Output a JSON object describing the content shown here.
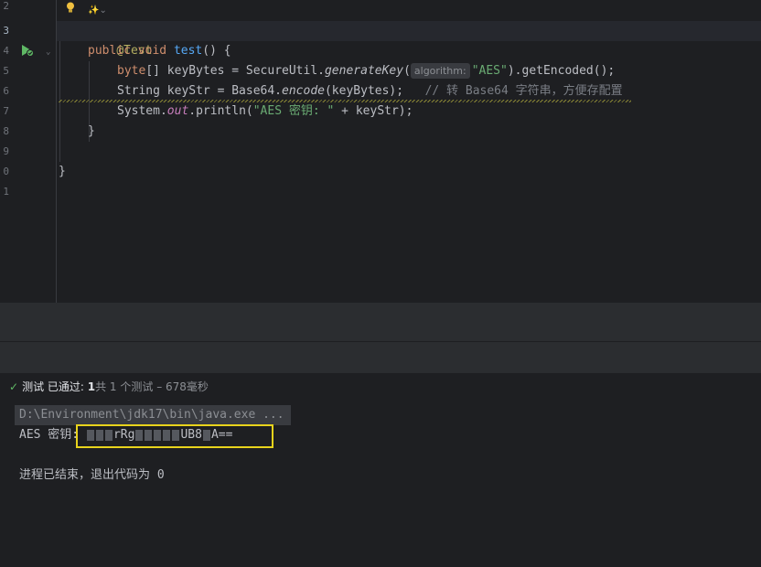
{
  "editor": {
    "line_numbers": [
      "2",
      "3",
      "4",
      "5",
      "6",
      "7",
      "8",
      "9",
      "0",
      "1"
    ],
    "ai_hint": "✨⌄",
    "lines": {
      "annotation": "@Test",
      "method_sig": {
        "kw1": "public",
        "kw2": "void",
        "name": "test",
        "rest": "() {"
      },
      "line5": {
        "kw": "byte",
        "a": "[] keyBytes = SecureUtil.",
        "m": "generateKey",
        "b": "(",
        "hint": "algorithm:",
        "str": "\"AES\"",
        "c": ").getEncoded();"
      },
      "line6": {
        "a": "String keyStr = Base64.",
        "m": "encode",
        "b": "(keyBytes);",
        "cmt": "// 转 Base64 字符串，方便存配置"
      },
      "line7": {
        "a": "System.",
        "f": "out",
        "b": ".println(",
        "str": "\"AES 密钥: \"",
        "c": " + keyStr);"
      },
      "close1": "}",
      "close2": "}"
    }
  },
  "tests": {
    "status_label": "测试 已通过:",
    "count": "1",
    "total": "共 1 个测试 – 678毫秒"
  },
  "console": {
    "command": "D:\\Environment\\jdk17\\bin\\java.exe ...",
    "output_prefix": "AES 密钥:",
    "output_key_visible_1": "rRg",
    "output_key_visible_2": "UB8",
    "output_key_suffix": "A==",
    "exit_message": "进程已结束，退出代码为 0"
  },
  "colors": {
    "highlight_box": "#e8d31c",
    "pass": "#5fb865"
  }
}
